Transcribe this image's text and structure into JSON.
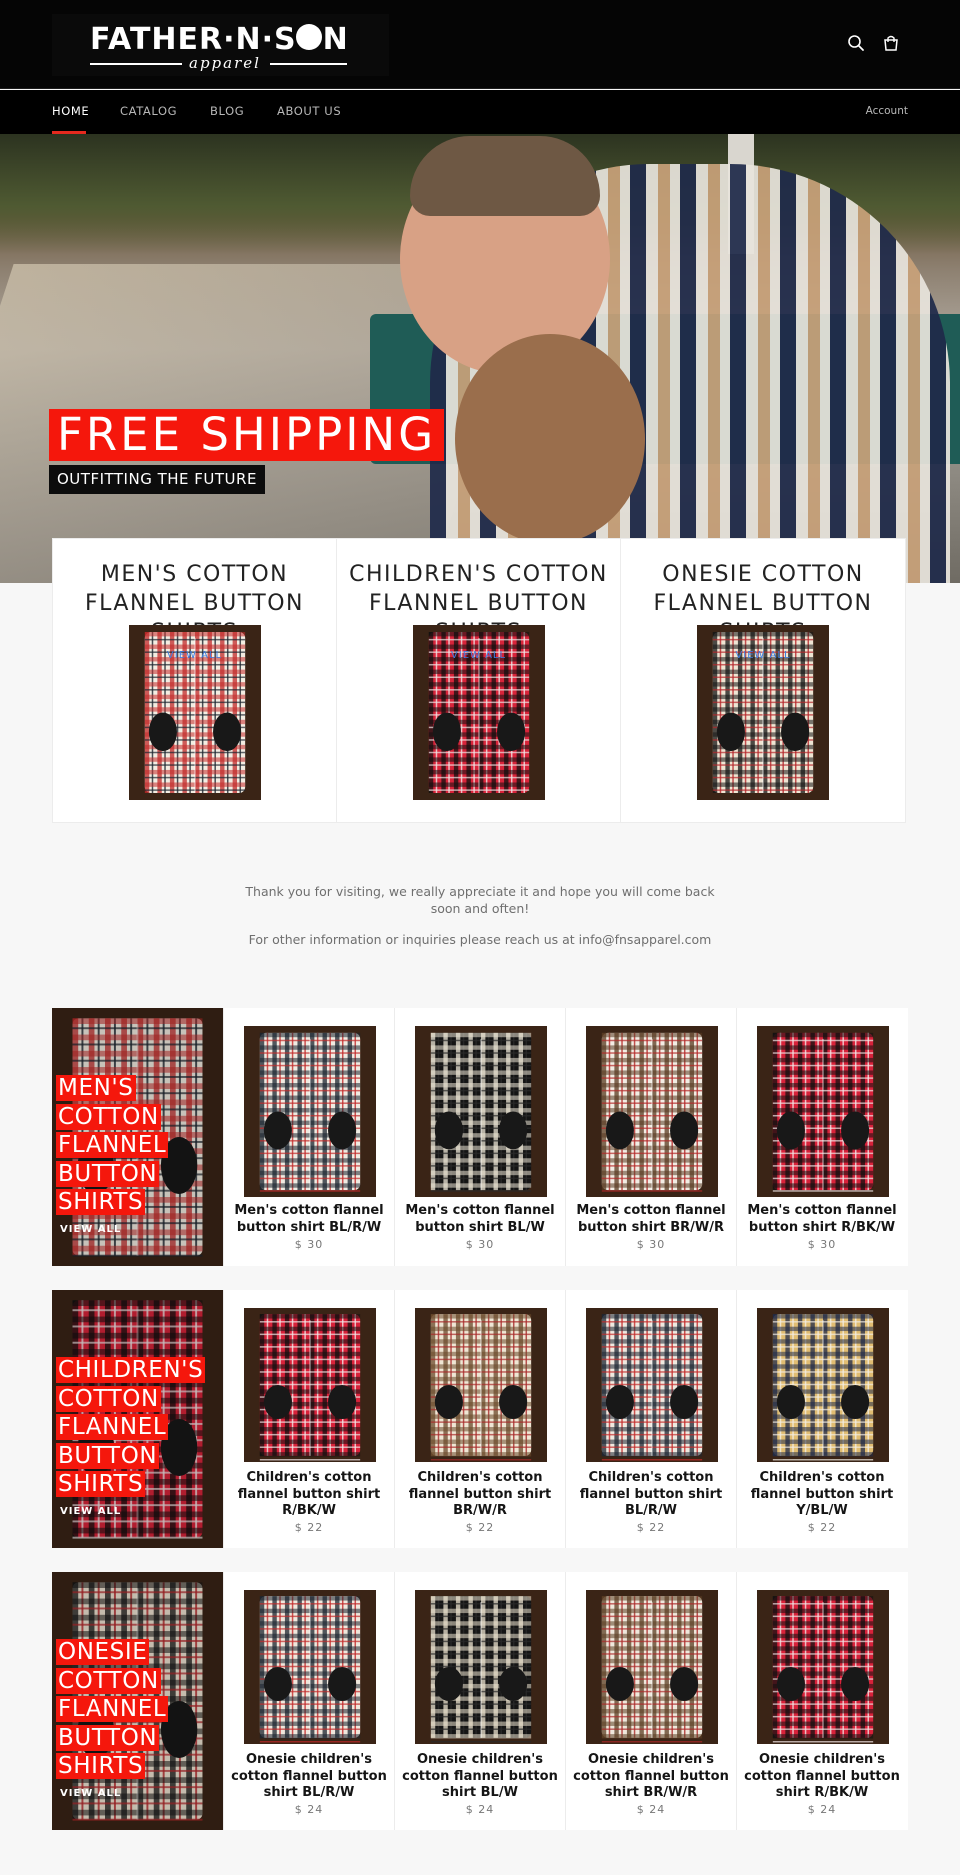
{
  "header": {
    "logo_main": "FATHER·N·S",
    "logo_tail": "N",
    "logo_sub": "apparel",
    "icons": [
      "search-icon",
      "cart-icon"
    ]
  },
  "nav": {
    "items": [
      {
        "label": "HOME",
        "active": true
      },
      {
        "label": "CATALOG"
      },
      {
        "label": "BLOG"
      },
      {
        "label": "ABOUT US"
      }
    ],
    "account": "Account"
  },
  "hero": {
    "title": "FREE SHIPPING",
    "subtitle": "OUTFITTING THE FUTURE"
  },
  "collections": [
    {
      "title": "MEN'S COTTON FLANNEL BUTTON SHIRTS",
      "link": "View all",
      "palette": [
        "#f3ede2",
        "#c22a2a",
        "#1c2530"
      ]
    },
    {
      "title": "CHILDREN'S COTTON FLANNEL BUTTON SHIRTS",
      "link": "View all",
      "palette": [
        "#d8243a",
        "#101010",
        "#f0e6e6"
      ]
    },
    {
      "title": "ONESIE COTTON FLANNEL BUTTON SHIRTS",
      "link": "View all",
      "palette": [
        "#efe5d3",
        "#151515",
        "#b5262b"
      ]
    }
  ],
  "message": {
    "line1": "Thank you for visiting, we really appreciate it and hope you will come back soon and often!",
    "line2": "For other information or inquiries please reach us at info@fnsapparel.com"
  },
  "sections": [
    {
      "feature_title": "MEN'S COTTON FLANNEL BUTTON SHIRTS",
      "feature_words": [
        "MEN'S",
        "COTTON",
        "FLANNEL",
        "BUTTON",
        "SHIRTS"
      ],
      "view_all": "VIEW ALL",
      "products": [
        {
          "name": "Men's cotton flannel button shirt BL/R/W",
          "price": "$ 30",
          "palette": [
            "#f0ebe2",
            "#1c2530",
            "#c22a2a"
          ]
        },
        {
          "name": "Men's cotton flannel button shirt BL/W",
          "price": "$ 30",
          "palette": [
            "#141414",
            "#ece6d6",
            "#2b2b2b"
          ]
        },
        {
          "name": "Men's cotton flannel button shirt BR/W/R",
          "price": "$ 30",
          "palette": [
            "#f2ede4",
            "#5a3b22",
            "#b42828"
          ]
        },
        {
          "name": "Men's cotton flannel button shirt R/BK/W",
          "price": "$ 30",
          "palette": [
            "#d8223a",
            "#101010",
            "#f2e8e8"
          ]
        }
      ]
    },
    {
      "feature_title": "CHILDREN'S COTTON FLANNEL BUTTON SHIRTS",
      "feature_words": [
        "CHILDREN'S",
        "COTTON",
        "FLANNEL",
        "BUTTON",
        "SHIRTS"
      ],
      "view_all": "VIEW ALL",
      "products": [
        {
          "name": "Children's cotton flannel button shirt R/BK/W",
          "price": "$ 22",
          "palette": [
            "#d8223a",
            "#101010",
            "#f2e8e8"
          ]
        },
        {
          "name": "Children's cotton flannel button shirt BR/W/R",
          "price": "$ 22",
          "palette": [
            "#efe6d4",
            "#6b4a2c",
            "#a82a2a"
          ]
        },
        {
          "name": "Children's cotton flannel button shirt BL/R/W",
          "price": "$ 22",
          "palette": [
            "#efe9e0",
            "#1d2633",
            "#c32b2b"
          ]
        },
        {
          "name": "Children's cotton flannel button shirt Y/BL/W",
          "price": "$ 22",
          "palette": [
            "#e1bd72",
            "#1f2a48",
            "#f2ede2"
          ]
        }
      ]
    },
    {
      "feature_title": "ONESIE COTTON FLANNEL BUTTON SHIRTS",
      "feature_words": [
        "ONESIE",
        "COTTON",
        "FLANNEL",
        "BUTTON",
        "SHIRTS"
      ],
      "view_all": "VIEW ALL",
      "products": [
        {
          "name": "Onesie children's cotton flannel button shirt BL/R/W",
          "price": "$ 24",
          "palette": [
            "#efe7dc",
            "#1c2530",
            "#c22a2a"
          ]
        },
        {
          "name": "Onesie children's cotton flannel button shirt BL/W",
          "price": "$ 24",
          "palette": [
            "#151515",
            "#ece3cf",
            "#2a2a2a"
          ]
        },
        {
          "name": "Onesie children's cotton flannel button shirt BR/W/R",
          "price": "$ 24",
          "palette": [
            "#efe8dc",
            "#5c3f24",
            "#ad2a2a"
          ]
        },
        {
          "name": "Onesie children's cotton flannel button shirt R/BK/W",
          "price": "$ 24",
          "palette": [
            "#d8223a",
            "#111111",
            "#f0e4e4"
          ]
        }
      ]
    }
  ],
  "colors": {
    "accent": "#f5170c",
    "header_bg": "#050505",
    "page_bg": "#f7f7f7",
    "link": "#3d7de0"
  }
}
